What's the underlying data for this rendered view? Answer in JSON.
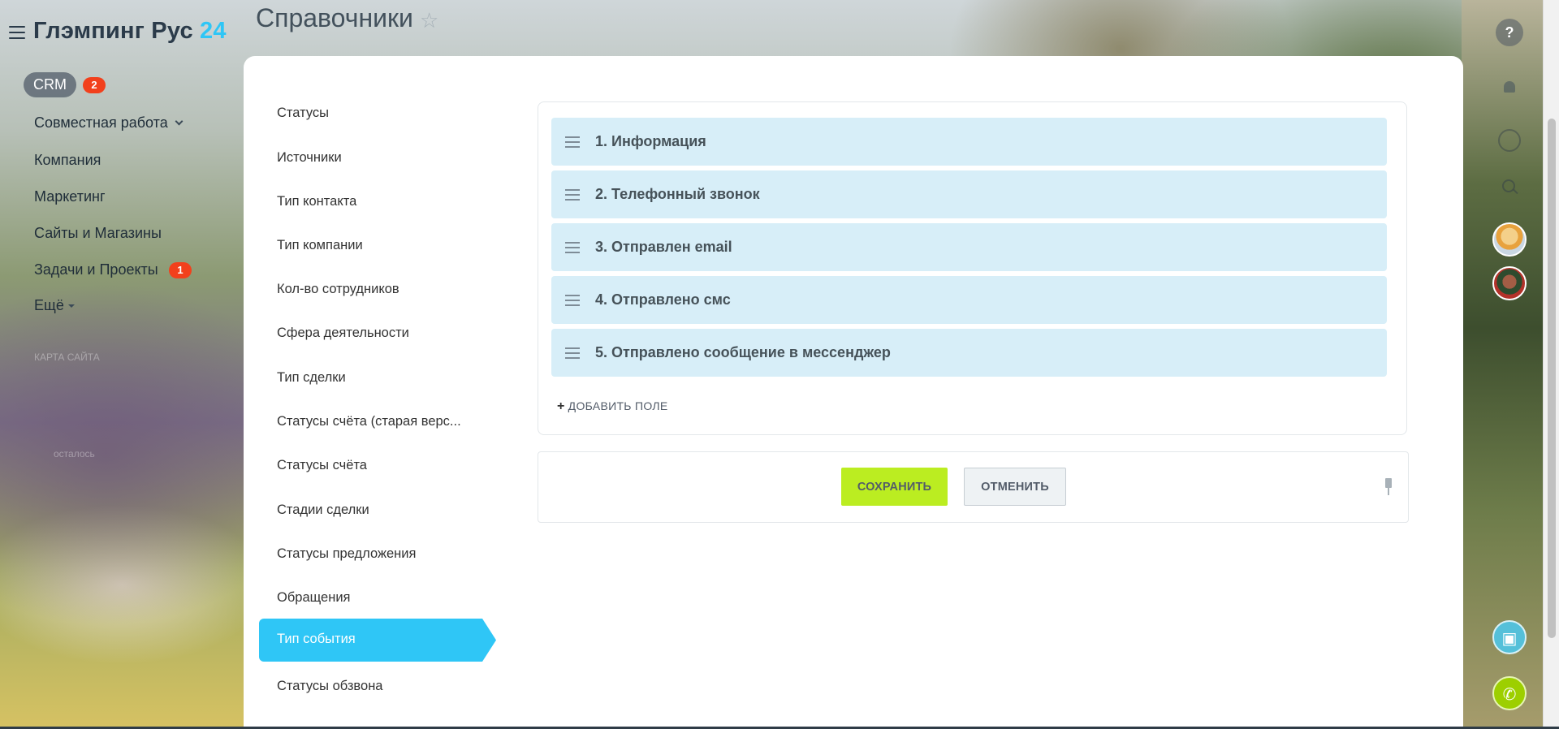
{
  "portal": {
    "name": "Глэмпинг Рус",
    "suffix": "24"
  },
  "left_nav": {
    "items": [
      {
        "label": "CRM",
        "badge": "2"
      },
      {
        "label": "Совместная работа"
      },
      {
        "label": "Компания"
      },
      {
        "label": "Маркетинг"
      },
      {
        "label": "Сайты и Магазины"
      },
      {
        "label": "Задачи и Проекты",
        "badge": "1"
      },
      {
        "label": "Ещё"
      }
    ],
    "faded": [
      "КАРТА САЙТА",
      "осталось"
    ]
  },
  "header": {
    "title": "Справочники"
  },
  "right_rail": {
    "help_label": "?"
  },
  "directory_menu": {
    "items": [
      "Статусы",
      "Источники",
      "Тип контакта",
      "Тип компании",
      "Кол-во сотрудников",
      "Сфера деятельности",
      "Тип сделки",
      "Статусы счёта (старая верс...",
      "Статусы счёта",
      "Стадии сделки",
      "Статусы предложения",
      "Обращения",
      "Тип события",
      "Статусы обзвона"
    ],
    "active": "Тип события"
  },
  "fields": [
    "1. Информация",
    "2. Телефонный звонок",
    "3. Отправлен email",
    "4. Отправлено смс",
    "5. Отправлено сообщение в мессенджер"
  ],
  "add_field_label": "ДОБАВИТЬ ПОЛЕ",
  "actions": {
    "save_label": "СОХРАНИТЬ",
    "cancel_label": "ОТМЕНИТЬ"
  },
  "colors": {
    "accent": "#2fc6f6",
    "save": "#bbed21",
    "badge": "#f2401c",
    "field_bg": "#d7eef8"
  }
}
